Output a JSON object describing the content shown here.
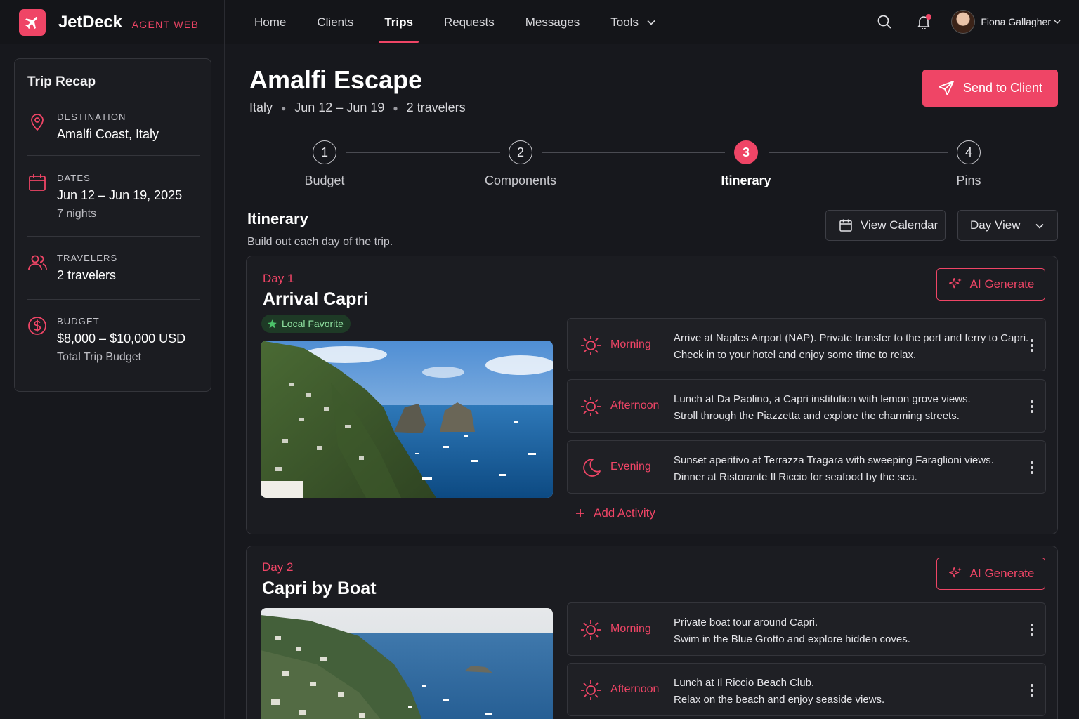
{
  "brand": {
    "name": "JetDeck",
    "sub": "AGENT WEB"
  },
  "nav": {
    "items": [
      {
        "label": "Home"
      },
      {
        "label": "Clients"
      },
      {
        "label": "Trips"
      },
      {
        "label": "Requests"
      },
      {
        "label": "Messages"
      },
      {
        "label": "Tools"
      }
    ],
    "active": "Trips"
  },
  "user": {
    "name": "Fiona Gallagher"
  },
  "sidebar": {
    "title": "Trip Recap",
    "destination": {
      "label": "DESTINATION",
      "value": "Amalfi Coast, Italy"
    },
    "dates": {
      "label": "DATES",
      "value": "Jun 12 – Jun 19, 2025",
      "sub": "7 nights"
    },
    "travelers": {
      "label": "TRAVELERS",
      "value": "2 travelers"
    },
    "budget": {
      "label": "BUDGET",
      "value": "$8,000 – $10,000 USD",
      "sub": "Total Trip Budget"
    }
  },
  "trip": {
    "title": "Amalfi Escape",
    "country": "Italy",
    "dates": "Jun 12 – Jun 19",
    "travelers": "2 travelers",
    "send_label": "Send to Client"
  },
  "steps": [
    {
      "num": "1",
      "label": "Budget"
    },
    {
      "num": "2",
      "label": "Components"
    },
    {
      "num": "3",
      "label": "Itinerary"
    },
    {
      "num": "4",
      "label": "Pins"
    }
  ],
  "itinerary": {
    "title": "Itinerary",
    "subtitle": "Build out each day of the trip.",
    "view_calendar": "View Calendar",
    "view_select": "Day View"
  },
  "days": [
    {
      "label": "Day 1",
      "title": "Arrival Capri",
      "badge": "Local Favorite",
      "ai_label": "AI Generate",
      "add_label": "Add Activity",
      "activities": [
        {
          "period": "Morning",
          "icon": "sun-icon",
          "line1": "Arrive at Naples Airport (NAP). Private transfer to the port and ferry to Capri.",
          "line2": "Check in to your hotel and enjoy some time to relax."
        },
        {
          "period": "Afternoon",
          "icon": "sun-icon",
          "line1": "Lunch at Da Paolino, a Capri institution with lemon grove views.",
          "line2": "Stroll through the Piazzetta and explore the charming streets."
        },
        {
          "period": "Evening",
          "icon": "moon-icon",
          "line1": "Sunset aperitivo at Terrazza Tragara with sweeping Faraglioni views.",
          "line2": "Dinner at Ristorante Il Riccio for seafood by the sea."
        }
      ]
    },
    {
      "label": "Day 2",
      "title": "Capri by Boat",
      "ai_label": "AI Generate",
      "activities": [
        {
          "period": "Morning",
          "icon": "sun-icon",
          "line1": "Private boat tour around Capri.",
          "line2": "Swim in the Blue Grotto and explore hidden coves."
        },
        {
          "period": "Afternoon",
          "icon": "sun-icon",
          "line1": "Lunch at Il Riccio Beach Club.",
          "line2": "Relax on the beach and enjoy seaside views."
        }
      ]
    }
  ],
  "colors": {
    "accent": "#ef4566",
    "background": "#17181d",
    "card": "#1b1c21",
    "badge_text": "#8fe0a0"
  }
}
